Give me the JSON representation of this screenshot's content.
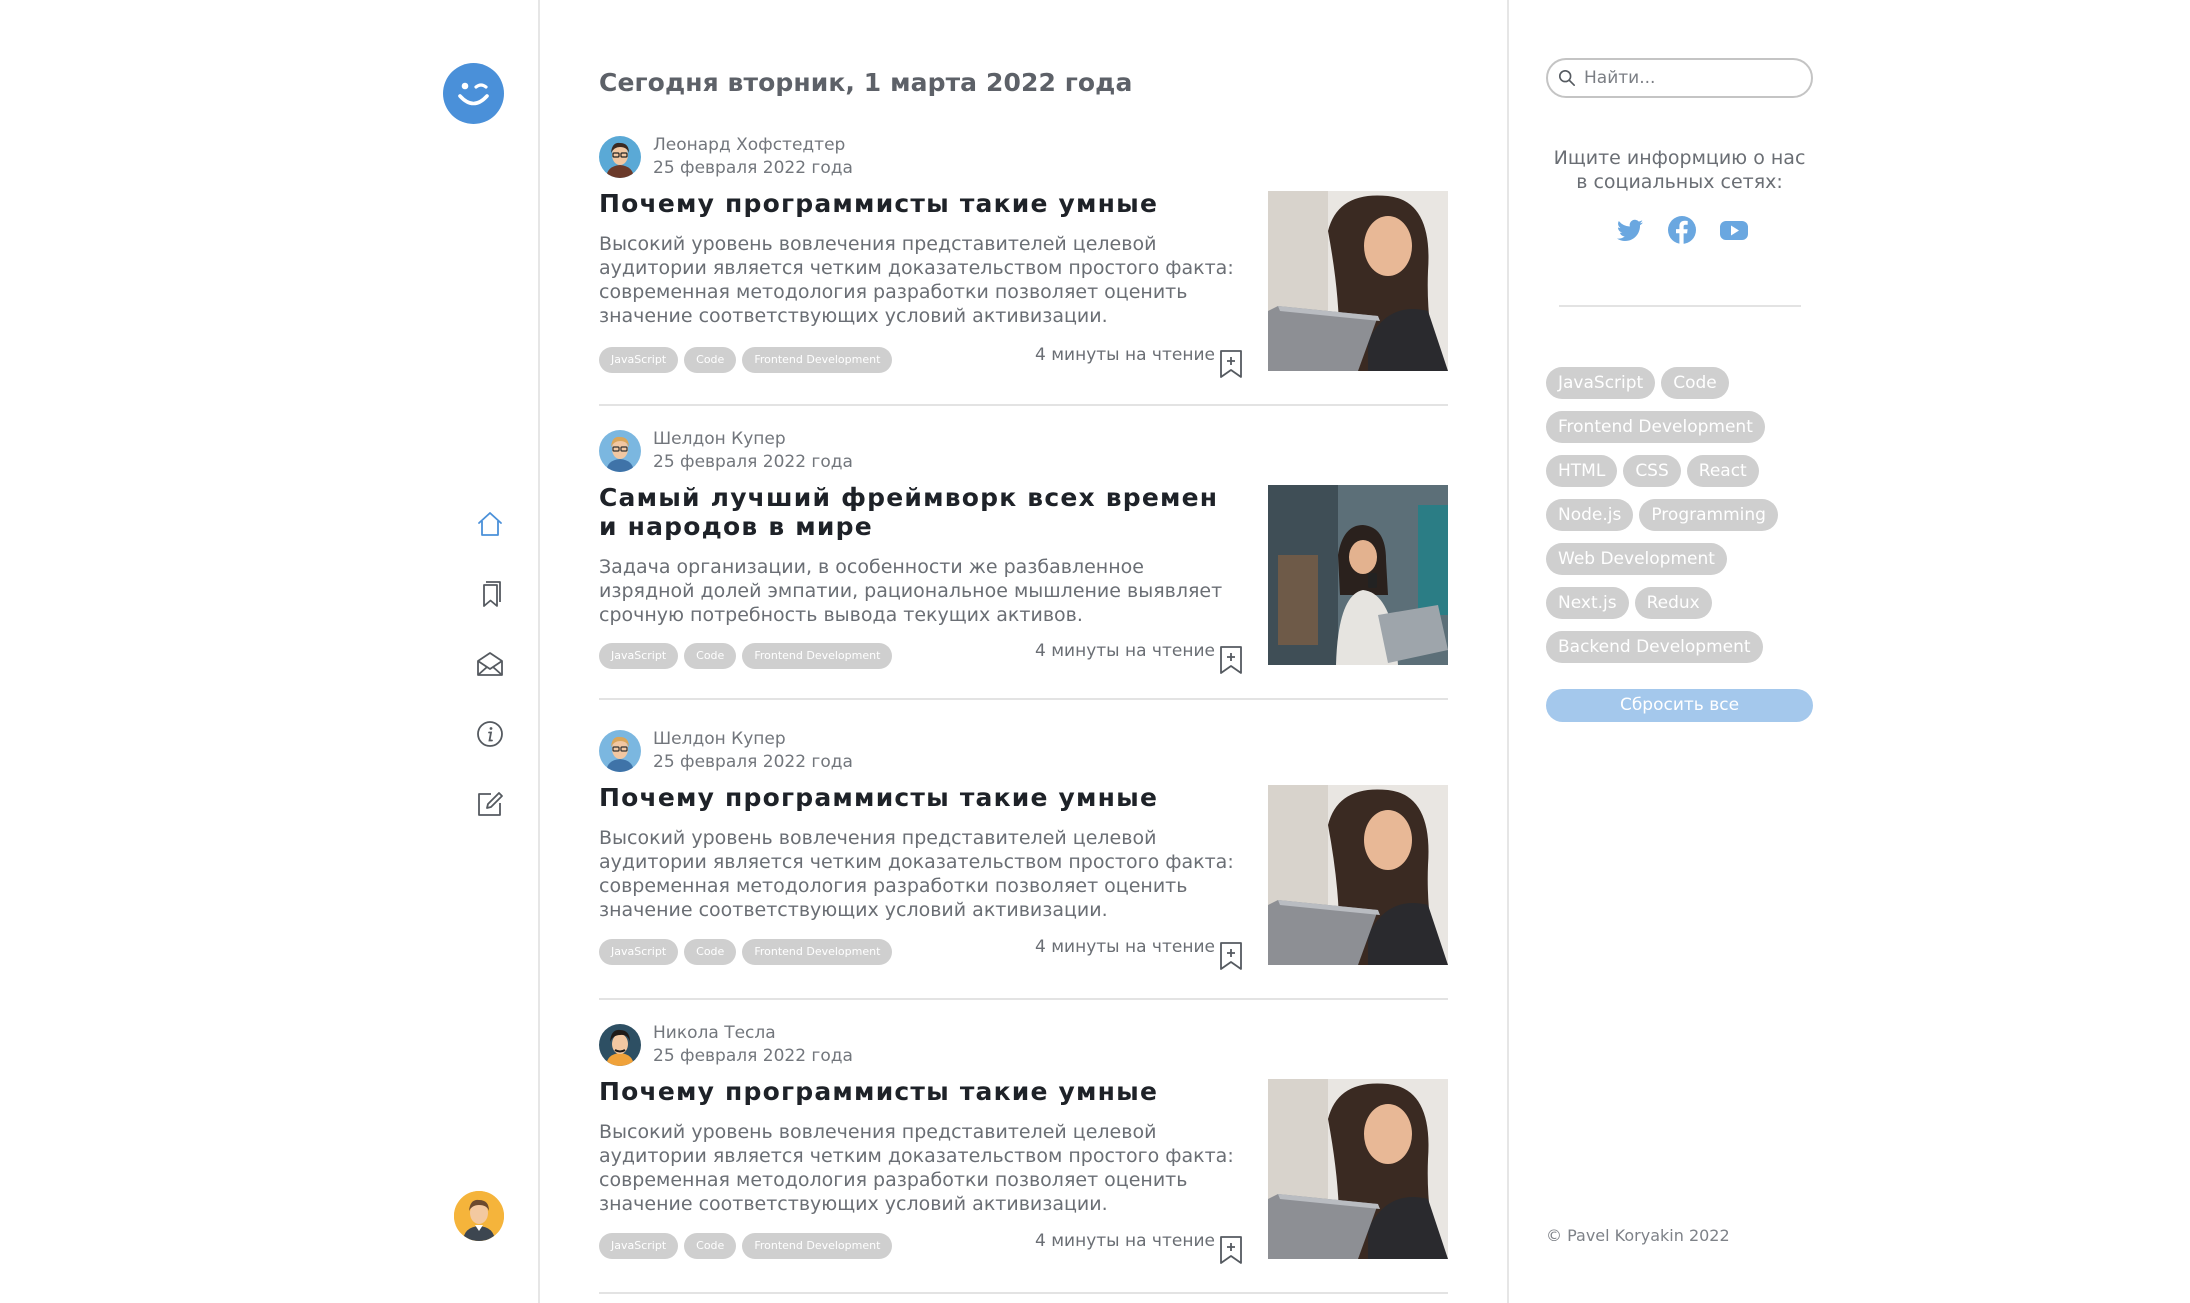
{
  "colors": {
    "accent": "#4a90d9",
    "tag_bg": "#cfcfcf",
    "reset_bg": "#a4c8ec",
    "divider": "#e3e3e3"
  },
  "left_sidebar": {
    "logo_icon": "winking-smiley-icon",
    "nav": [
      {
        "icon": "home-icon"
      },
      {
        "icon": "bookmarks-icon"
      },
      {
        "icon": "mail-icon"
      },
      {
        "icon": "info-icon"
      },
      {
        "icon": "edit-icon"
      }
    ],
    "user_avatar_icon": "user-avatar-icon"
  },
  "main": {
    "title": "Сегодня вторник, 1 марта 2022 года",
    "posts": [
      {
        "author": "Леонард Хофстедтер",
        "date": "25 февраля 2022 года",
        "title": "Почему программисты такие умные",
        "text": "Высокий уровень вовлечения представителей целевой аудитории является четким доказательством простого факта: современная методология разработки позволяет оценить значение соответствующих условий активизации.",
        "tags": [
          "JavaScript",
          "Code",
          "Frontend Development"
        ],
        "read_time": "4 минуты на чтение"
      },
      {
        "author": "Шелдон Купер",
        "date": "25 февраля 2022 года",
        "title": "Самый лучший фреймворк всех времен и народов в мире",
        "text": "Задача организации, в особенности же разбавленное изрядной долей эмпатии, рациональное мышление выявляет срочную потребность вывода текущих активов.",
        "tags": [
          "JavaScript",
          "Code",
          "Frontend Development"
        ],
        "read_time": "4 минуты на чтение"
      },
      {
        "author": "Шелдон Купер",
        "date": "25 февраля 2022 года",
        "title": "Почему программисты такие умные",
        "text": "Высокий уровень вовлечения представителей целевой аудитории является четким доказательством простого факта: современная методология разработки позволяет оценить значение соответствующих условий активизации.",
        "tags": [
          "JavaScript",
          "Code",
          "Frontend Development"
        ],
        "read_time": "4 минуты на чтение"
      },
      {
        "author": "Никола Тесла",
        "date": "25 февраля 2022 года",
        "title": "Почему программисты такие умные",
        "text": "Высокий уровень вовлечения представителей целевой аудитории является четким доказательством простого факта: современная методология разработки позволяет оценить значение соответствующих условий активизации.",
        "tags": [
          "JavaScript",
          "Code",
          "Frontend Development"
        ],
        "read_time": "4 минуты на чтение"
      }
    ]
  },
  "right_sidebar": {
    "search_placeholder": "Найти...",
    "social_text": "Ищите информцию о нас в социальных сетях:",
    "social": [
      "twitter-icon",
      "facebook-icon",
      "youtube-icon"
    ],
    "tags": [
      [
        "JavaScript",
        "Code"
      ],
      [
        "Frontend Development"
      ],
      [
        "HTML",
        "CSS",
        "React"
      ],
      [
        "Node.js",
        "Programming"
      ],
      [
        "Web Development"
      ],
      [
        "Next.js",
        "Redux"
      ],
      [
        "Backend Development"
      ]
    ],
    "reset_label": "Сбросить все",
    "copyright": "© Pavel Koryakin 2022"
  }
}
